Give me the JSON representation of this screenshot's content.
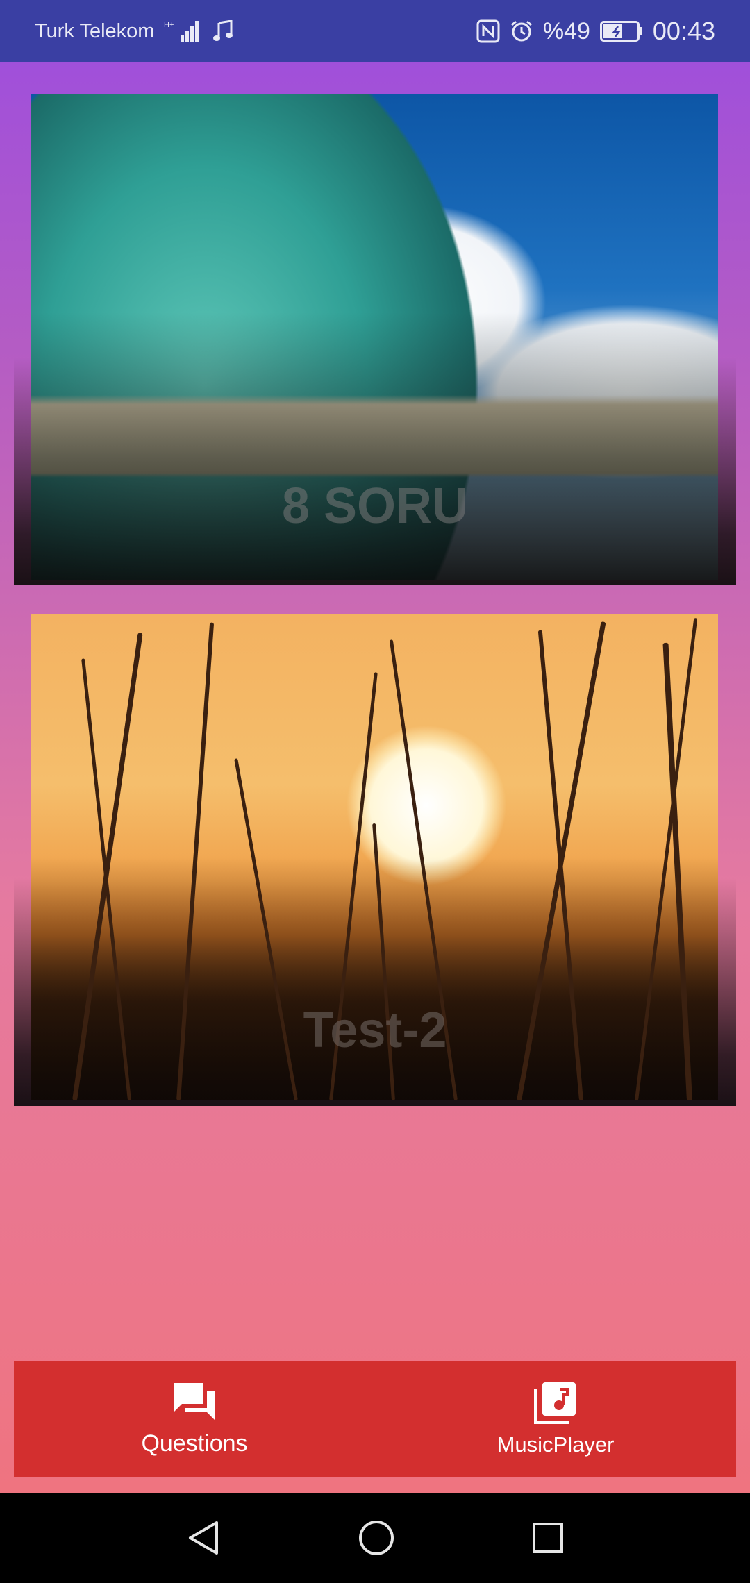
{
  "status_bar": {
    "carrier": "Turk Telekom",
    "network_type": "H+",
    "battery": "%49",
    "time": "00:43",
    "icons": [
      "signal-icon",
      "music-note-icon",
      "nfc-icon",
      "alarm-icon",
      "battery-icon"
    ]
  },
  "cards": [
    {
      "title": "8 SORU",
      "image": "ocean-wave-beach-photo"
    },
    {
      "title": "Test-2",
      "image": "sunset-grass-photo"
    }
  ],
  "bottom_nav": {
    "items": [
      {
        "label": "Questions",
        "icon": "forum-icon"
      },
      {
        "label": "MusicPlayer",
        "icon": "library-music-icon"
      }
    ],
    "color": "#d32f2f"
  },
  "colors": {
    "status_bar_bg": "#3a3fa3",
    "gradient_top": "#9c4ddf",
    "gradient_bottom": "#ef7480"
  },
  "system_nav": [
    "back-icon",
    "home-icon",
    "recents-icon"
  ]
}
